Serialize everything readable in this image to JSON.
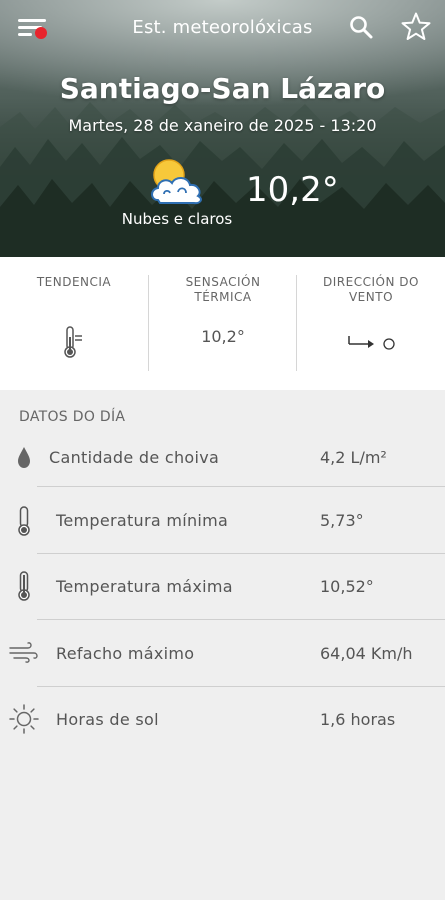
{
  "header": {
    "app_title": "Est. meteorolóxicas",
    "menu_icon": "menu-icon",
    "notification_color": "#e8242c",
    "search_icon": "search-icon",
    "favorite_icon": "star-outline-icon"
  },
  "station": {
    "name": "Santiago-San Lázaro",
    "datetime": "Martes, 28 de xaneiro de 2025 - 13:20",
    "condition_icon": "sun-behind-clouds-icon",
    "condition": "Nubes e claros",
    "temperature": "10,2°"
  },
  "current": {
    "trend_label": "TENDENCIA",
    "trend_icon": "thermometer-steady-icon",
    "feels_like_label": "SENSACIÓN TÉRMICA",
    "feels_like_value": "10,2°",
    "wind_dir_label": "DIRECCIÓN DO VENTO",
    "wind_dir_icon": "wind-direction-arrow-icon"
  },
  "day_data": {
    "title": "DATOS DO DÍA",
    "rows": [
      {
        "icon": "raindrop-icon",
        "label": "Cantidade de choiva",
        "value": "4,2 L/m²"
      },
      {
        "icon": "thermometer-low-icon",
        "label": "Temperatura mínima",
        "value": "5,73°"
      },
      {
        "icon": "thermometer-high-icon",
        "label": "Temperatura máxima",
        "value": "10,52°"
      },
      {
        "icon": "wind-gust-icon",
        "label": "Refacho máximo",
        "value": "64,04 Km/h"
      },
      {
        "icon": "sun-icon",
        "label": "Horas de sol",
        "value": "1,6 horas"
      }
    ]
  }
}
